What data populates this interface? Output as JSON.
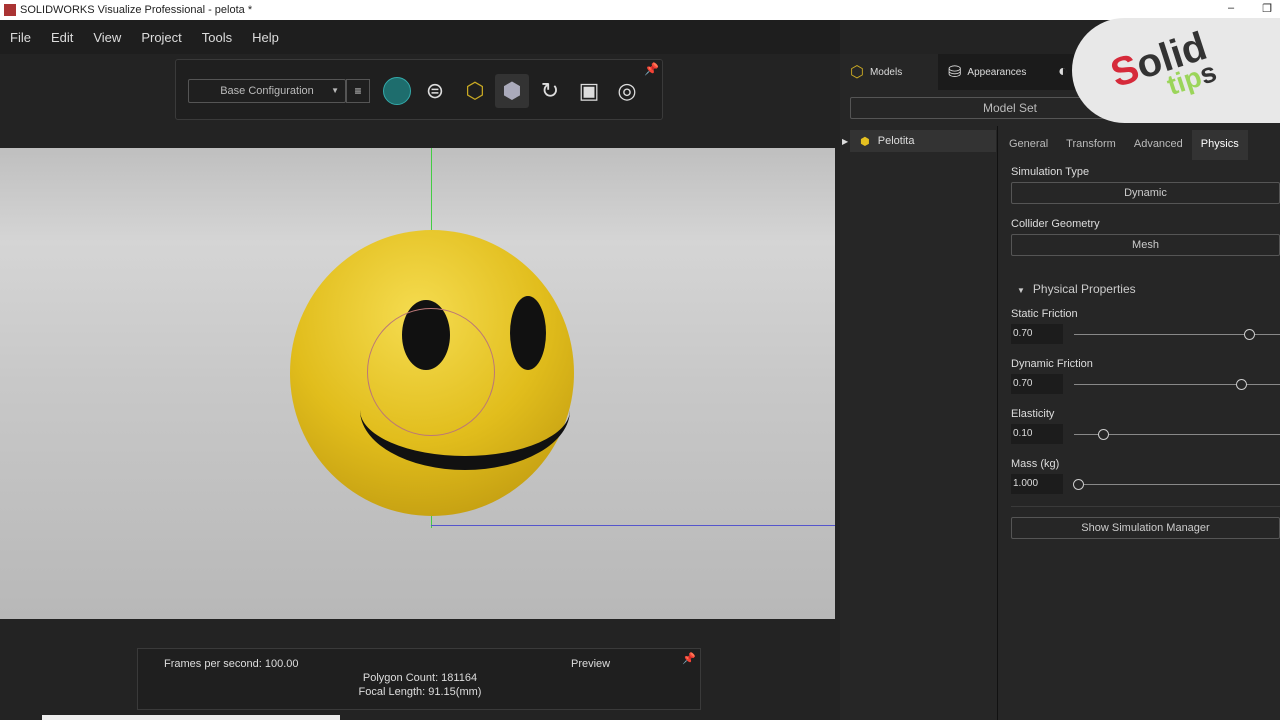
{
  "window": {
    "title": "SOLIDWORKS Visualize Professional - pelota *",
    "minimize": "–",
    "restore": "❐"
  },
  "menu": [
    "File",
    "Edit",
    "View",
    "Project",
    "Tools",
    "Help"
  ],
  "toolbar": {
    "configuration": "Base Configuration"
  },
  "status": {
    "fps": "Frames per second: 100.00",
    "mode": "Preview",
    "polygons": "Polygon Count: 181164",
    "focal": "Focal Length: 91.15(mm)"
  },
  "panel": {
    "tabs": [
      "Models",
      "Appearances"
    ],
    "model_set": "Model Set",
    "tree_item": "Pelotita",
    "prop_tabs": [
      "General",
      "Transform",
      "Advanced",
      "Physics"
    ],
    "sim_type_label": "Simulation Type",
    "sim_type": "Dynamic",
    "collider_label": "Collider Geometry",
    "collider": "Mesh",
    "section": "Physical Properties",
    "sliders": [
      {
        "label": "Static Friction",
        "value": "0.70",
        "fraction": 0.85
      },
      {
        "label": "Dynamic Friction",
        "value": "0.70",
        "fraction": 0.81
      },
      {
        "label": "Elasticity",
        "value": "0.10",
        "fraction": 0.14
      },
      {
        "label": "Mass (kg)",
        "value": "1.000",
        "fraction": 0.02
      }
    ],
    "sim_manager": "Show Simulation Manager"
  },
  "watermark": {
    "text1": "Solid",
    "text2": "tips"
  }
}
